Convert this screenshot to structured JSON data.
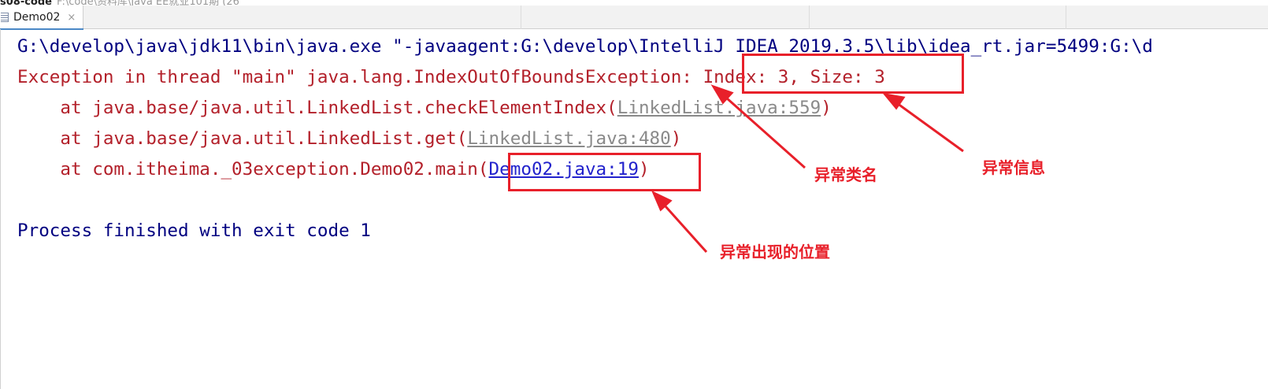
{
  "title_strip": {
    "project": "s08-code",
    "path": "F:\\code\\资料库\\Java EE就业101期 (26"
  },
  "editor": {
    "tab_label": "Demo02",
    "tab_close": "×"
  },
  "console": {
    "cmd": "G:\\develop\\java\\jdk11\\bin\\java.exe \"-javaagent:G:\\develop\\IntelliJ IDEA 2019.3.5\\lib\\idea_rt.jar=5499:G:\\d",
    "exception_prefix": "Exception in thread \"main\" java.lang.IndexOutOfBoundsException:",
    "exception_message": " Index: 3, Size: 3",
    "frames": [
      {
        "prefix": "    at java.base/java.util.LinkedList.checkElementIndex(",
        "link": "LinkedList.java:559",
        "suffix": ")"
      },
      {
        "prefix": "    at java.base/java.util.LinkedList.get(",
        "link": "LinkedList.java:480",
        "suffix": ")"
      },
      {
        "prefix": "    at com.itheima._03exception.Demo02.main",
        "open": "(",
        "link": "Demo02.java:19",
        "suffix": ")"
      }
    ],
    "exit_text": "Process finished with exit code 1"
  },
  "annotations": {
    "exception_class": "异常类名",
    "exception_info": "异常信息",
    "exception_location": "异常出现的位置"
  },
  "colors": {
    "annotation_red": "#e8202a",
    "command_navy": "#000080",
    "error_red": "#b3202a",
    "link_blue": "#2222cc",
    "link_gray": "#8a8a8a"
  }
}
